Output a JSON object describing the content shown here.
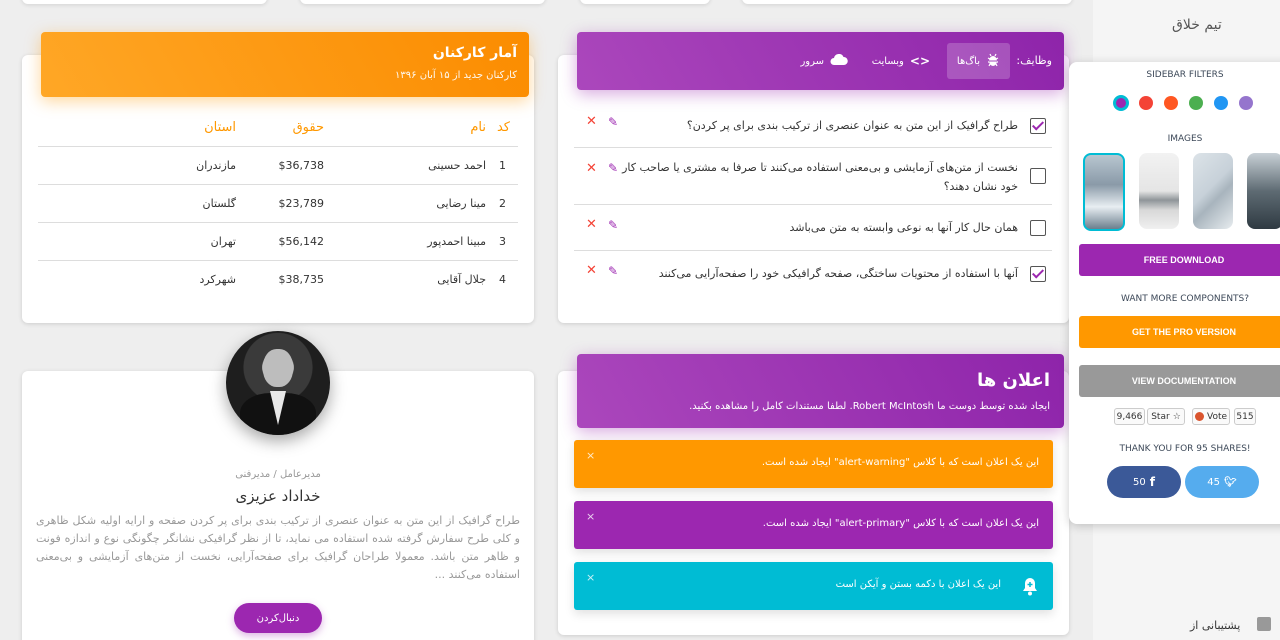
{
  "stats": {
    "title": "آمار کارکنان",
    "subtitle": "کارکنان جدید از ۱۵ آبان ۱۳۹۶",
    "headers": [
      "کد",
      "نام",
      "حقوق",
      "استان"
    ],
    "rows": [
      [
        "1",
        "احمد حسینی",
        "$36,738",
        "مازندران"
      ],
      [
        "2",
        "مینا رضایی",
        "$23,789",
        "گلستان"
      ],
      [
        "3",
        "مبینا احمدپور",
        "$56,142",
        "تهران"
      ],
      [
        "4",
        "جلال آقایی",
        "$38,735",
        "شهرکرد"
      ]
    ]
  },
  "tasks": {
    "title": "وظایف:",
    "tabs": [
      "باگ‌ها",
      "وبسایت",
      "سرور"
    ],
    "items": [
      {
        "text": "طراح گرافیک از این متن به عنوان عنصری از ترکیب بندی برای پر کردن؟",
        "checked": true
      },
      {
        "text": "نخست از متن‌های آزمایشی و بی‌معنی استفاده می‌کنند تا صرفا به مشتری یا صاحب کار خود نشان دهند؟",
        "checked": false
      },
      {
        "text": "همان حال کار آنها به نوعی وابسته به متن می‌باشد",
        "checked": false
      },
      {
        "text": "آنها با استفاده از محتویات ساختگی، صفحه گرافیکی خود را صفحه‌آرایی می‌کنند",
        "checked": true
      }
    ]
  },
  "profile": {
    "role": "مدیرعامل / مدیرفنی",
    "name": "خداداد عزیزی",
    "description": "طراح گرافیک از این متن به عنوان عنصری از ترکیب بندی برای پر کردن صفحه و ارایه اولیه شکل ظاهری و کلی طرح سفارش گرفته شده استفاده می نماید، تا از نظر گرافیکی نشانگر چگونگی نوع و اندازه فونت و ظاهر متن باشد. معمولا طراحان گرافیک برای صفحه‌آرایی، نخست از متن‌های آزمایشی و بی‌معنی استفاده می‌کنند ...",
    "follow_label": "دنبال‌کردن"
  },
  "notifications": {
    "title": "اعلان ها",
    "subtitle": "ایجاد شده توسط دوست ما Robert McIntosh. لطفا مستندات کامل را مشاهده بکنید.",
    "alerts": [
      {
        "text": "این یک اعلان است که با کلاس \"alert-warning\" ایجاد شده است.",
        "color": "#ff9800"
      },
      {
        "text": "این یک اعلان است که با کلاس \"alert-primary\" ایجاد شده است.",
        "color": "#9c27b0"
      },
      {
        "text": "این یک اعلان با دکمه بستن و آیکن است",
        "color": "#00bcd4"
      }
    ],
    "close_glyph": "×"
  },
  "sidebar": {
    "brand": "تیم خلاق",
    "support_text": "پشتیبانی از"
  },
  "fixed_plugin": {
    "filters_title": "SIDEBAR FILTERS",
    "filter_colors": [
      "#9c27b0",
      "#f44336",
      "#ff9800",
      "#4caf50",
      "#03a9f4",
      "#9575cd"
    ],
    "images_title": "IMAGES",
    "free_download": "FREE DOWNLOAD",
    "want_more": "WANT MORE COMPONENTS?",
    "pro_version": "GET THE PRO VERSION",
    "documentation": "VIEW DOCUMENTATION",
    "github": {
      "stars": "9,466",
      "star_label": "Star",
      "vote_label": "Vote",
      "votes": "515"
    },
    "thanks": "THANK YOU FOR 95 SHARES!",
    "twitter_count": "45",
    "facebook_count": "50"
  },
  "colors": {
    "orange": "#ff9800",
    "purple": "#9c27b0",
    "cyan": "#00bcd4",
    "grey": "#999999"
  }
}
